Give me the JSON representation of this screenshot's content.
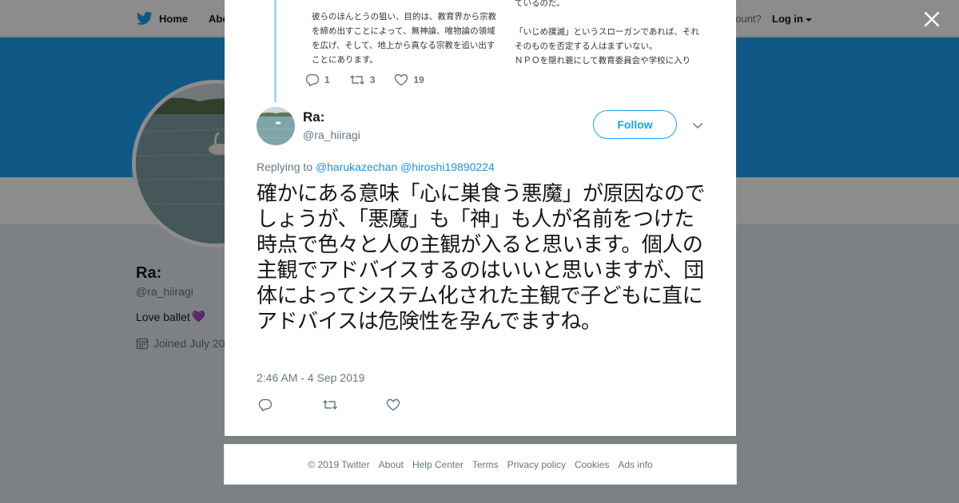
{
  "nav": {
    "home_label": "Home",
    "about_label": "Abo",
    "account_text": "account?",
    "login_label": "Log in"
  },
  "profile": {
    "name": "Ra:",
    "handle": "@ra_hiiragi",
    "bio": "Love ballet",
    "bio_emoji": "💜",
    "joined": "Joined July 20",
    "banner_color": "#1da1f2"
  },
  "previous_tweet": {
    "image_text_left": "彼らのほんとうの狙い、目的は、教育界から宗教を締め出すことによって、無神論、唯物論の領域を広げ、そして、地上から真なる宗教を追い出すことにあります。",
    "image_text_right_lines": [
      "ているのだ。",
      "",
      "「いじめ撲滅」というスローガンであれば、それそのものを否定する人はまずいない。",
      "ＮＰＯを隠れ蓑にして教育委員会や学校に入り"
    ],
    "replies": "1",
    "retweets": "3",
    "likes": "19"
  },
  "tweet": {
    "name": "Ra:",
    "handle": "@ra_hiiragi",
    "follow_label": "Follow",
    "replying_prefix": "Replying to",
    "replying_to": [
      "@harukazechan",
      "@hiroshi19890224"
    ],
    "text": "確かにある意味「心に巣食う悪魔」が原因なのでしょうが、「悪魔」も「神」も人が名前をつけた時点で色々と人の主観が入ると思います。個人の主観でアドバイスするのはいいと思いますが、団体によってシステム化された主観で子どもに直にアドバイスは危険性を孕んでますね。",
    "timestamp": "2:46 AM - 4 Sep 2019"
  },
  "footer": {
    "copyright": "© 2019 Twitter",
    "links": [
      "About",
      "Help Center",
      "Terms",
      "Privacy policy",
      "Cookies",
      "Ads info"
    ]
  },
  "colors": {
    "accent": "#1da1f2",
    "link": "#1b95e0",
    "text": "#14171a",
    "secondary": "#657786"
  }
}
